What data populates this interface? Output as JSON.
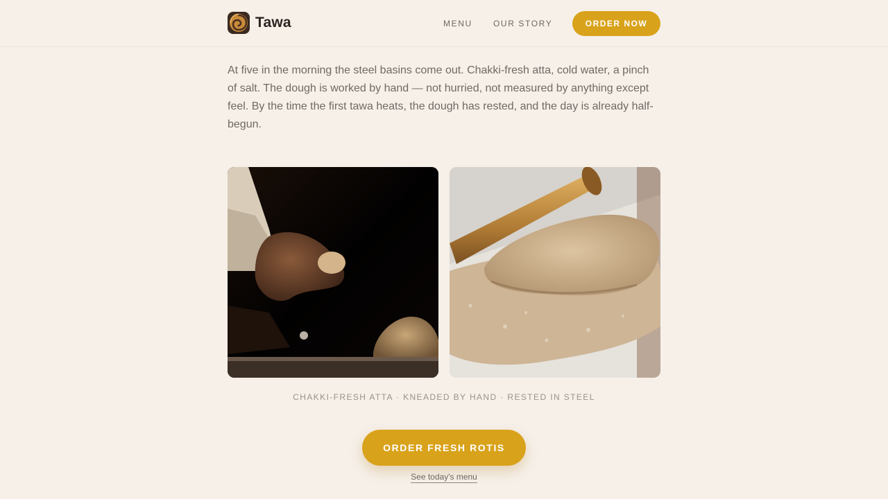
{
  "header": {
    "brand_name": "Tawa",
    "logo_icon": "swirl-logo-icon",
    "nav": [
      {
        "label": "MENU"
      },
      {
        "label": "OUR STORY"
      }
    ],
    "order_button_label": "ORDER NOW"
  },
  "intro": {
    "text": "At five in the morning the steel basins come out. Chakki-fresh atta, cold water, a pinch of salt. The dough is worked by hand — not hurried, not measured by anything except feel. By the time the first tawa heats, the dough has rested, and the day is already half-begun."
  },
  "gallery": {
    "caption": "CHAKKI-FRESH ATTA · KNEADED BY HAND · RESTED IN STEEL"
  },
  "cta": {
    "button_label": "ORDER FRESH ROTIS",
    "menu_link_label": "See today's menu"
  },
  "colors": {
    "background": "#f6f0e9",
    "accent": "#d9a21b",
    "text": "#716964"
  }
}
